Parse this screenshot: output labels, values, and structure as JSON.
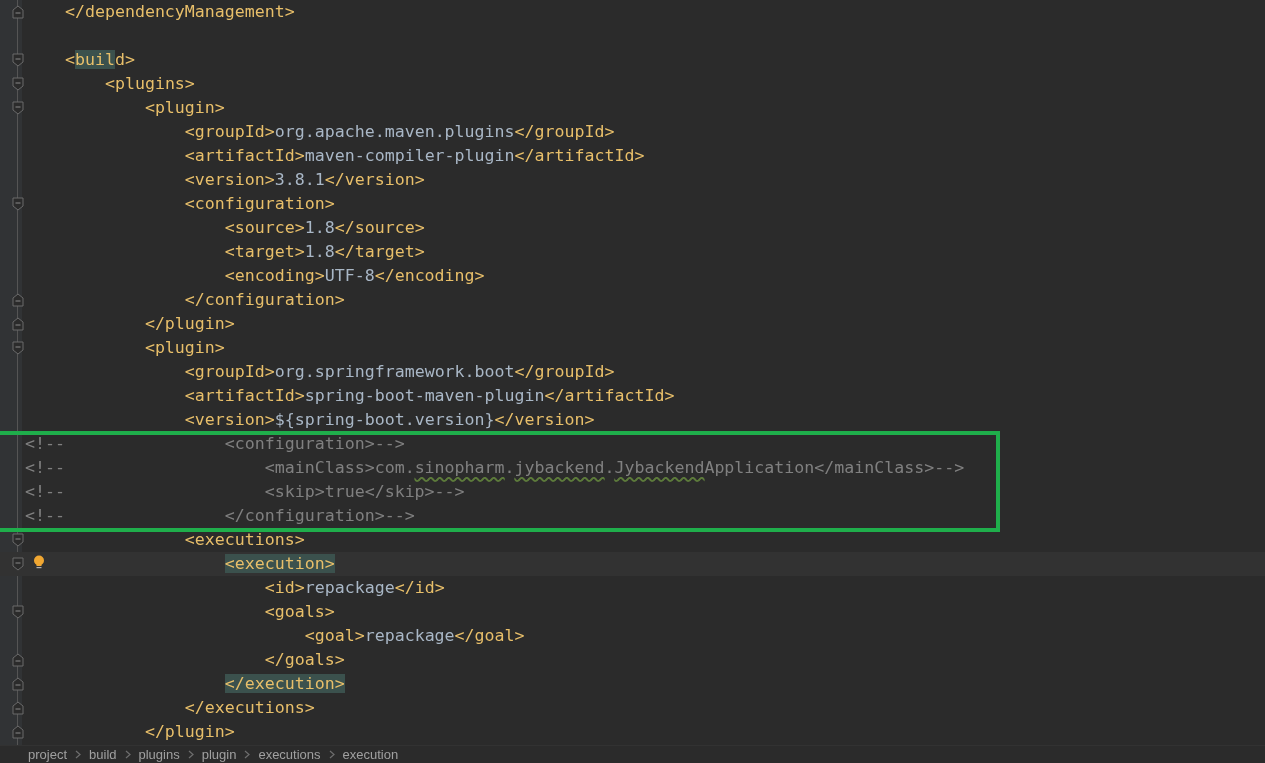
{
  "editor": {
    "lines": [
      {
        "fold_end": true,
        "tokens": [
          {
            "kind": "tag",
            "text": "    </dependencyManagement>"
          }
        ]
      },
      {
        "blank": true
      },
      {
        "fold_start": true,
        "tokens": [
          {
            "kind": "tag",
            "text": "    <"
          },
          {
            "kind": "tag",
            "text": "buil",
            "highlighted": true
          },
          {
            "kind": "tag",
            "text": "d>"
          }
        ]
      },
      {
        "fold_start": true,
        "tokens": [
          {
            "kind": "tag",
            "text": "        <plugins>"
          }
        ]
      },
      {
        "fold_start": true,
        "tokens": [
          {
            "kind": "tag",
            "text": "            <plugin>"
          }
        ]
      },
      {
        "tokens": [
          {
            "kind": "tag",
            "text": "                <groupId>"
          },
          {
            "kind": "value",
            "text": "org.apache.maven.plugins"
          },
          {
            "kind": "tag",
            "text": "</groupId>"
          }
        ]
      },
      {
        "tokens": [
          {
            "kind": "tag",
            "text": "                <artifactId>"
          },
          {
            "kind": "value",
            "text": "maven-compiler-plugin"
          },
          {
            "kind": "tag",
            "text": "</artifactId>"
          }
        ]
      },
      {
        "tokens": [
          {
            "kind": "tag",
            "text": "                <version>"
          },
          {
            "kind": "value",
            "text": "3.8.1"
          },
          {
            "kind": "tag",
            "text": "</version>"
          }
        ]
      },
      {
        "fold_start": true,
        "tokens": [
          {
            "kind": "tag",
            "text": "                <configuration>"
          }
        ]
      },
      {
        "tokens": [
          {
            "kind": "tag",
            "text": "                    <source>"
          },
          {
            "kind": "value",
            "text": "1.8"
          },
          {
            "kind": "tag",
            "text": "</source>"
          }
        ]
      },
      {
        "tokens": [
          {
            "kind": "tag",
            "text": "                    <target>"
          },
          {
            "kind": "value",
            "text": "1.8"
          },
          {
            "kind": "tag",
            "text": "</target>"
          }
        ]
      },
      {
        "tokens": [
          {
            "kind": "tag",
            "text": "                    <encoding>"
          },
          {
            "kind": "value",
            "text": "UTF-8"
          },
          {
            "kind": "tag",
            "text": "</encoding>"
          }
        ]
      },
      {
        "fold_end": true,
        "tokens": [
          {
            "kind": "tag",
            "text": "                </configuration>"
          }
        ]
      },
      {
        "fold_end": true,
        "tokens": [
          {
            "kind": "tag",
            "text": "            </plugin>"
          }
        ]
      },
      {
        "fold_start": true,
        "tokens": [
          {
            "kind": "tag",
            "text": "            <plugin>"
          }
        ]
      },
      {
        "tokens": [
          {
            "kind": "tag",
            "text": "                <groupId>"
          },
          {
            "kind": "value",
            "text": "org.springframework.boot"
          },
          {
            "kind": "tag",
            "text": "</groupId>"
          }
        ]
      },
      {
        "tokens": [
          {
            "kind": "tag",
            "text": "                <artifactId>"
          },
          {
            "kind": "value",
            "text": "spring-boot-maven-plugin"
          },
          {
            "kind": "tag",
            "text": "</artifactId>"
          }
        ]
      },
      {
        "tokens": [
          {
            "kind": "tag",
            "text": "                <version>"
          },
          {
            "kind": "value",
            "text": "${spring-boot.version}"
          },
          {
            "kind": "tag",
            "text": "</version>"
          }
        ]
      },
      {
        "tokens": [
          {
            "kind": "comment",
            "text": "<!--                <configuration>-->"
          }
        ]
      },
      {
        "tokens": [
          {
            "kind": "comment",
            "text": "<!--                    <mainClass>com."
          },
          {
            "kind": "comment",
            "text": "sinopharm",
            "typo": true
          },
          {
            "kind": "comment",
            "text": "."
          },
          {
            "kind": "comment",
            "text": "jybackend",
            "typo": true
          },
          {
            "kind": "comment",
            "text": "."
          },
          {
            "kind": "comment",
            "text": "Jybackend",
            "typo": true
          },
          {
            "kind": "comment",
            "text": "Application</mainClass>-->"
          }
        ]
      },
      {
        "tokens": [
          {
            "kind": "comment",
            "text": "<!--                    <skip>true</skip>-->"
          }
        ]
      },
      {
        "tokens": [
          {
            "kind": "comment",
            "text": "<!--                </configuration>-->"
          }
        ]
      },
      {
        "fold_start": true,
        "tokens": [
          {
            "kind": "tag",
            "text": "                <executions>"
          }
        ]
      },
      {
        "fold_start": true,
        "current": true,
        "bulb": true,
        "tokens": [
          {
            "kind": "tag",
            "text": "                    <execution>",
            "highlighted": true
          }
        ]
      },
      {
        "tokens": [
          {
            "kind": "tag",
            "text": "                        <id>"
          },
          {
            "kind": "value",
            "text": "repackage"
          },
          {
            "kind": "tag",
            "text": "</id>"
          }
        ]
      },
      {
        "fold_start": true,
        "tokens": [
          {
            "kind": "tag",
            "text": "                        <goals>"
          }
        ]
      },
      {
        "tokens": [
          {
            "kind": "tag",
            "text": "                            <goal>"
          },
          {
            "kind": "value",
            "text": "repackage"
          },
          {
            "kind": "tag",
            "text": "</goal>"
          }
        ]
      },
      {
        "fold_end": true,
        "tokens": [
          {
            "kind": "tag",
            "text": "                        </goals>"
          }
        ]
      },
      {
        "fold_end": true,
        "tokens": [
          {
            "kind": "tag",
            "text": "                    </execution>",
            "highlighted": true
          }
        ]
      },
      {
        "fold_end": true,
        "tokens": [
          {
            "kind": "tag",
            "text": "                </executions>"
          }
        ]
      },
      {
        "fold_end": true,
        "tokens": [
          {
            "kind": "tag",
            "text": "            </plugin>"
          }
        ]
      }
    ]
  },
  "breadcrumbs": [
    "project",
    "build",
    "plugins",
    "plugin",
    "executions",
    "execution"
  ]
}
